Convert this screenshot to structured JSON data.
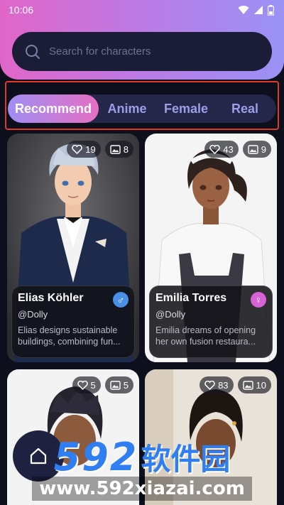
{
  "status": {
    "time": "10:06"
  },
  "search": {
    "placeholder": "Search for characters"
  },
  "tabs": [
    {
      "label": "Recommend",
      "active": true
    },
    {
      "label": "Anime",
      "active": false
    },
    {
      "label": "Female",
      "active": false
    },
    {
      "label": "Real",
      "active": false
    }
  ],
  "cards": [
    {
      "name": "Elias Köhler",
      "handle": "@Dolly",
      "description": "Elias designs sustainable buildings, combining fun...",
      "likes": "19",
      "images": "8",
      "gender": "male",
      "gender_color": "#4a8fe6"
    },
    {
      "name": "Emilia Torres",
      "handle": "@Dolly",
      "description": "Emilia dreams of opening her own fusion restaura...",
      "likes": "43",
      "images": "9",
      "gender": "female",
      "gender_color": "#d962d6"
    },
    {
      "likes": "5",
      "images": "5"
    },
    {
      "likes": "83",
      "images": "10"
    }
  ],
  "watermark": {
    "number": "592",
    "brand": "软件园",
    "url": "www.592xiazai.com"
  },
  "colors": {
    "accent_start": "#9f8ef3",
    "accent_end": "#e66fc4",
    "background": "#0d0f1c"
  },
  "icons": {
    "search": "search-icon",
    "like": "heart-icon",
    "images": "image-icon",
    "home": "home-icon"
  }
}
